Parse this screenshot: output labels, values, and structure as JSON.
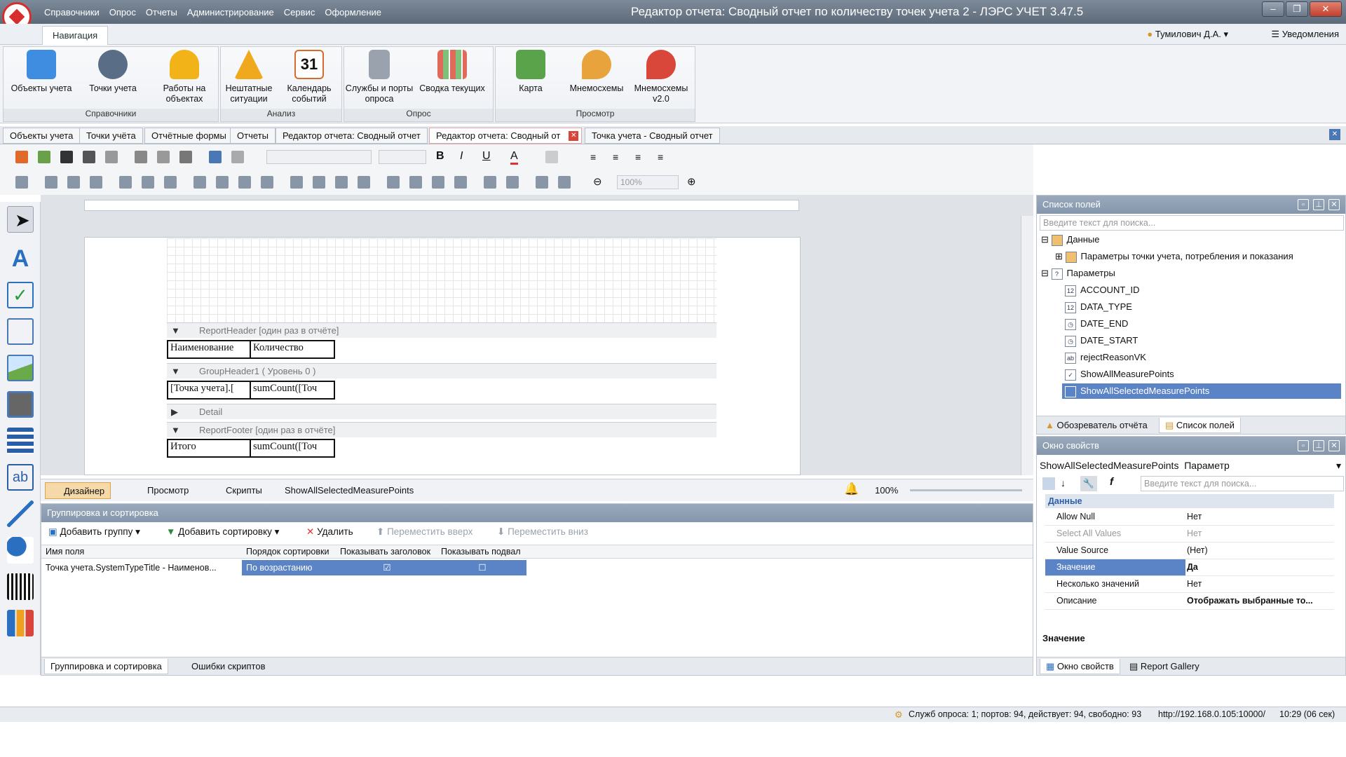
{
  "app": {
    "title": "Редактор отчета: Сводный отчет по количеству точек учета 2 - ЛЭРС УЧЕТ 3.47.5",
    "menu": [
      "Справочники",
      "Опрос",
      "Отчеты",
      "Администрирование",
      "Сервис",
      "Оформление"
    ]
  },
  "ribbon": {
    "tab": "Навигация",
    "user": "Тумилович Д.А.",
    "notifications": "Уведомления",
    "groups": [
      {
        "label": "Справочники",
        "items": [
          "Объекты учета",
          "Точки учета",
          "Работы на объектах"
        ]
      },
      {
        "label": "Анализ",
        "items": [
          "Нештатные ситуации",
          "Календарь событий"
        ]
      },
      {
        "label": "Опрос",
        "items": [
          "Службы и порты опроса",
          "Сводка текущих"
        ]
      },
      {
        "label": "Просмотр",
        "items": [
          "Карта",
          "Мнемосхемы",
          "Мнемосхемы v2.0"
        ]
      }
    ],
    "calendar_day": "31"
  },
  "doc_tabs": [
    "Объекты учета",
    "Точки учёта",
    "Отчётные формы",
    "Отчеты",
    "Редактор отчета: Сводный отчет",
    "Редактор отчета: Сводный от",
    "Точка учета - Сводный отчет"
  ],
  "toolbar": {
    "zoom": "100%"
  },
  "designer": {
    "bands": {
      "report_header": "ReportHeader [один раз в отчёте]",
      "group_header": "GroupHeader1 ( Уровень 0 )",
      "detail": "Detail",
      "report_footer": "ReportFooter [один раз в отчёте]"
    },
    "cells": {
      "name_header": "Наименование",
      "count_header": "Количество",
      "group_name": "[Точка учета].[",
      "group_count": "sumCount([Точ",
      "total_label": "Итого",
      "total_count": "sumCount([Точ"
    }
  },
  "modebar": {
    "designer": "Дизайнер",
    "preview": "Просмотр",
    "scripts": "Скрипты",
    "selected": "ShowAllSelectedMeasurePoints",
    "zoom": "100%"
  },
  "grouping": {
    "title": "Группировка и сортировка",
    "add_group": "Добавить группу",
    "add_sort": "Добавить сортировку",
    "delete": "Удалить",
    "move_up": "Переместить вверх",
    "move_down": "Переместить вниз",
    "columns": [
      "Имя поля",
      "Порядок сортировки",
      "Показывать заголовок",
      "Показывать подвал"
    ],
    "row": {
      "field": "Точка учета.SystemTypeTitle - Наименов...",
      "order": "По возрастанию"
    },
    "tabs": [
      "Группировка и сортировка",
      "Ошибки скриптов"
    ]
  },
  "fields_panel": {
    "title": "Список полей",
    "search_placeholder": "Введите текст для поиска...",
    "nodes": [
      {
        "label": "Данные",
        "icon": ""
      },
      {
        "label": "Параметры точки учета, потребления и показания",
        "icon": ""
      },
      {
        "label": "Параметры",
        "icon": "?"
      },
      {
        "label": "ACCOUNT_ID",
        "icon": "12"
      },
      {
        "label": "DATA_TYPE",
        "icon": "12"
      },
      {
        "label": "DATE_END",
        "icon": "◷"
      },
      {
        "label": "DATE_START",
        "icon": "◷"
      },
      {
        "label": "rejectReasonVK",
        "icon": "ab"
      },
      {
        "label": "ShowAllMeasurePoints",
        "icon": "✓"
      },
      {
        "label": "ShowAllSelectedMeasurePoints",
        "icon": ""
      }
    ],
    "tabs": [
      "Обозреватель отчёта",
      "Список полей"
    ]
  },
  "props_panel": {
    "title": "Окно свойств",
    "object": "ShowAllSelectedMeasurePoints",
    "object_type": "Параметр",
    "search_placeholder": "Введите текст для поиска...",
    "category": "Данные",
    "rows": [
      {
        "key": "Allow Null",
        "value": "Нет"
      },
      {
        "key": "Select All Values",
        "value": "Нет"
      },
      {
        "key": "Value Source",
        "value": "(Нет)"
      },
      {
        "key": "Значение",
        "value": "Да"
      },
      {
        "key": "Несколько значений",
        "value": "Нет"
      },
      {
        "key": "Описание",
        "value": "Отображать выбранные то..."
      }
    ],
    "description_title": "Значение",
    "tabs": [
      "Окно свойств",
      "Report Gallery"
    ]
  },
  "status": {
    "text": "Служб опроса: 1; портов: 94, действует: 94, свободно: 93",
    "url": "http://192.168.0.105:10000/",
    "time": "10:29 (06 сек)"
  }
}
